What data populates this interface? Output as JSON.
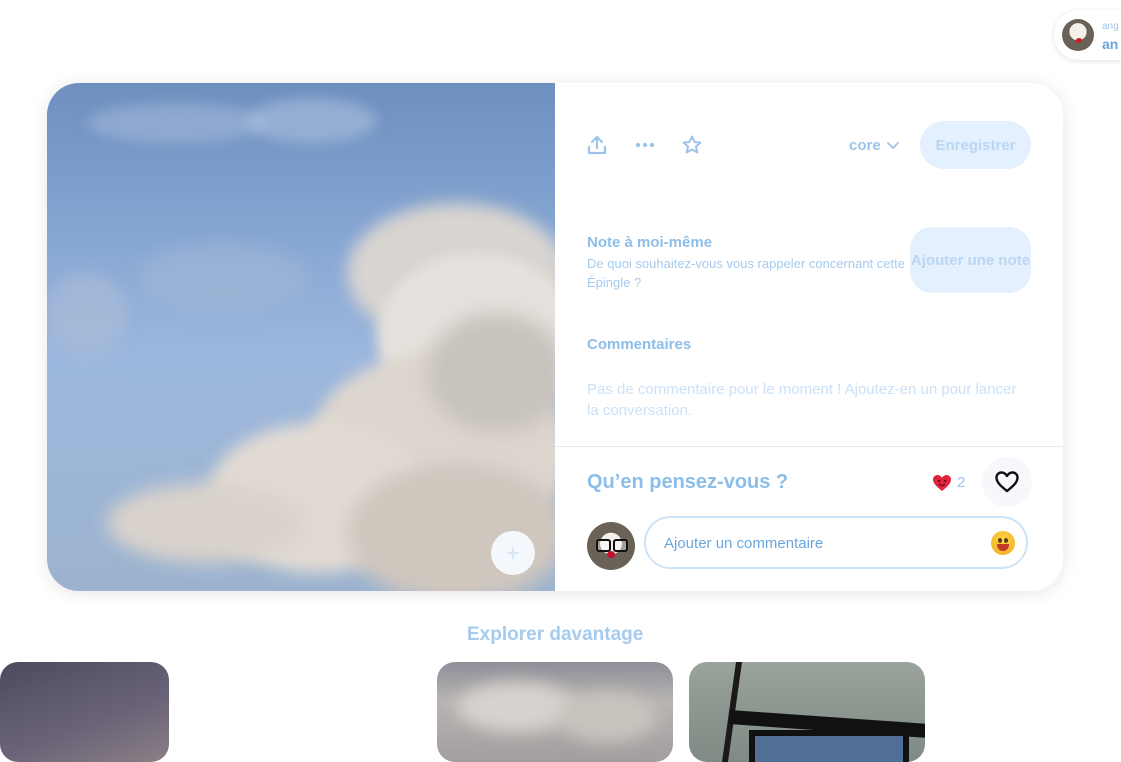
{
  "account": {
    "small_label": "ang",
    "big_label": "an"
  },
  "pin": {
    "image_alt": "Nuage cumulus dans un ciel bleu",
    "toolbar": {
      "share_icon": "upload-icon",
      "more_icon": "ellipsis-icon",
      "favorite_icon": "star-icon",
      "board_name": "core",
      "save_label": "Enregistrer"
    },
    "note": {
      "title": "Note à moi-même",
      "description": "De quoi souhaitez-vous vous rappeler concernant cette Épingle ?",
      "button_label": "Ajouter une note"
    },
    "comments": {
      "title": "Commentaires",
      "empty_text": "Pas de commentaire pour le moment ! Ajoutez-en un pour lancer la conversation."
    },
    "feedback": {
      "question": "Qu’en pensez-vous ?",
      "reaction_count": "2"
    },
    "comment_box": {
      "placeholder": "Ajouter un commentaire"
    }
  },
  "explore": {
    "title": "Explorer davantage"
  },
  "colors": {
    "accent": "#7ab4e6",
    "button_bg": "#e4f0fd",
    "reaction_red": "#e0233a"
  }
}
